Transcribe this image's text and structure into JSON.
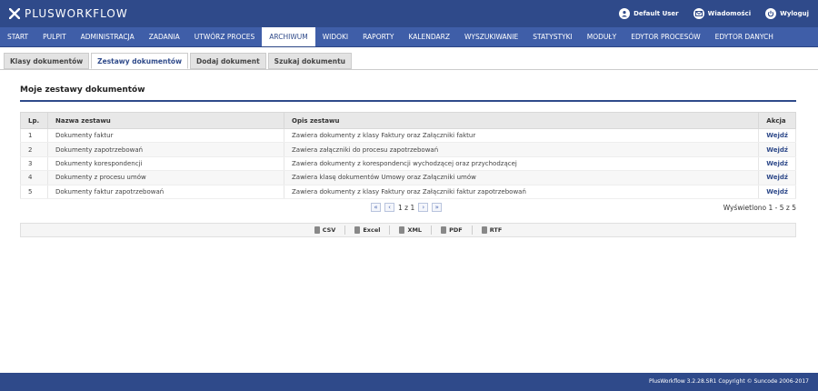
{
  "app": {
    "logo_text": "PLUSWORKFLOW"
  },
  "user_menu": [
    {
      "label": "Default User",
      "icon": "user-icon"
    },
    {
      "label": "Wiadomości",
      "icon": "mail-icon"
    },
    {
      "label": "Wyloguj",
      "icon": "power-icon"
    }
  ],
  "menu": [
    {
      "label": "START",
      "active": false
    },
    {
      "label": "PULPIT",
      "active": false
    },
    {
      "label": "ADMINISTRACJA",
      "active": false
    },
    {
      "label": "ZADANIA",
      "active": false
    },
    {
      "label": "UTWÓRZ PROCES",
      "active": false
    },
    {
      "label": "ARCHIWUM",
      "active": true
    },
    {
      "label": "WIDOKI",
      "active": false
    },
    {
      "label": "RAPORTY",
      "active": false
    },
    {
      "label": "KALENDARZ",
      "active": false
    },
    {
      "label": "WYSZUKIWANIE",
      "active": false
    },
    {
      "label": "STATYSTYKI",
      "active": false
    },
    {
      "label": "MODUŁY",
      "active": false
    },
    {
      "label": "EDYTOR PROCESÓW",
      "active": false
    },
    {
      "label": "EDYTOR DANYCH",
      "active": false
    }
  ],
  "tabs": [
    {
      "label": "Klasy dokumentów",
      "active": false
    },
    {
      "label": "Zestawy dokumentów",
      "active": true
    },
    {
      "label": "Dodaj dokument",
      "active": false
    },
    {
      "label": "Szukaj dokumentu",
      "active": false
    }
  ],
  "section_title": "Moje zestawy dokumentów",
  "table": {
    "headers": [
      "Lp.",
      "Nazwa zestawu",
      "Opis zestawu",
      "Akcja"
    ],
    "rows": [
      [
        "1",
        "Dokumenty faktur",
        "Zawiera dokumenty z klasy Faktury oraz Załączniki faktur",
        "Wejdź"
      ],
      [
        "2",
        "Dokumenty zapotrzebowań",
        "Zawiera załączniki do procesu zapotrzebowań",
        "Wejdź"
      ],
      [
        "3",
        "Dokumenty korespondencji",
        "Zawiera dokumenty z korespondencji wychodzącej oraz przychodzącej",
        "Wejdź"
      ],
      [
        "4",
        "Dokumenty z procesu umów",
        "Zawiera klasę dokumentów Umowy oraz Załączniki umów",
        "Wejdź"
      ],
      [
        "5",
        "Dokumenty faktur zapotrzebowań",
        "Zawiera dokumenty z klasy Faktury oraz Załączniki faktur zapotrzebowań",
        "Wejdź"
      ]
    ]
  },
  "pager": {
    "first": "«",
    "prev": "‹",
    "page_text": "1 z 1",
    "next": "›",
    "last": "»"
  },
  "count_text": "Wyświetlono 1 - 5 z 5",
  "exports": [
    "CSV",
    "Excel",
    "XML",
    "PDF",
    "RTF"
  ],
  "footer_text": "PlusWorkflow 3.2.28.SR1 Copyright © Suncode 2006-2017",
  "colors": {
    "brand": "#2f4a8a",
    "menu": "#3f5ea8"
  }
}
